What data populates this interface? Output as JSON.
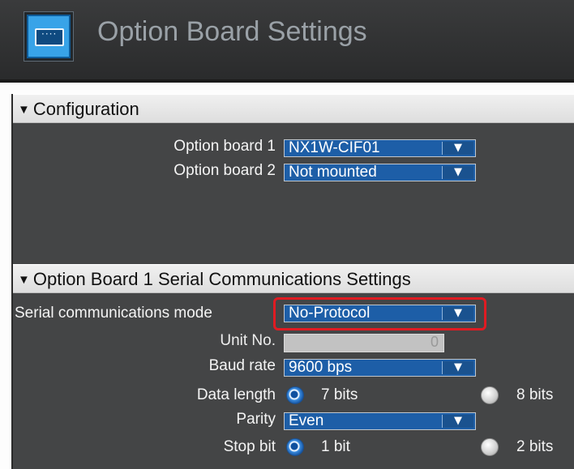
{
  "header": {
    "title": "Option Board Settings",
    "icon": "option-board-icon"
  },
  "configuration": {
    "section_label": "Configuration",
    "option_board_1": {
      "label": "Option board 1",
      "value": "NX1W-CIF01"
    },
    "option_board_2": {
      "label": "Option board 2",
      "value": "Not mounted"
    }
  },
  "serial": {
    "section_label": "Option Board 1 Serial Communications Settings",
    "mode": {
      "label": "Serial communications mode",
      "value": "No-Protocol"
    },
    "unit_no": {
      "label": "Unit No.",
      "value": "0"
    },
    "baud_rate": {
      "label": "Baud rate",
      "value": "9600 bps"
    },
    "data_length": {
      "label": "Data length",
      "options": [
        "7 bits",
        "8 bits"
      ],
      "selected": "7 bits"
    },
    "parity": {
      "label": "Parity",
      "value": "Even"
    },
    "stop_bit": {
      "label": "Stop bit",
      "options": [
        "1 bit",
        "2 bits"
      ],
      "selected": "1 bit"
    }
  },
  "colors": {
    "header_bg": "#2f3031",
    "panel_bg": "#444546",
    "combo_bg": "#1d5ea7",
    "highlight": "#e01b22"
  }
}
